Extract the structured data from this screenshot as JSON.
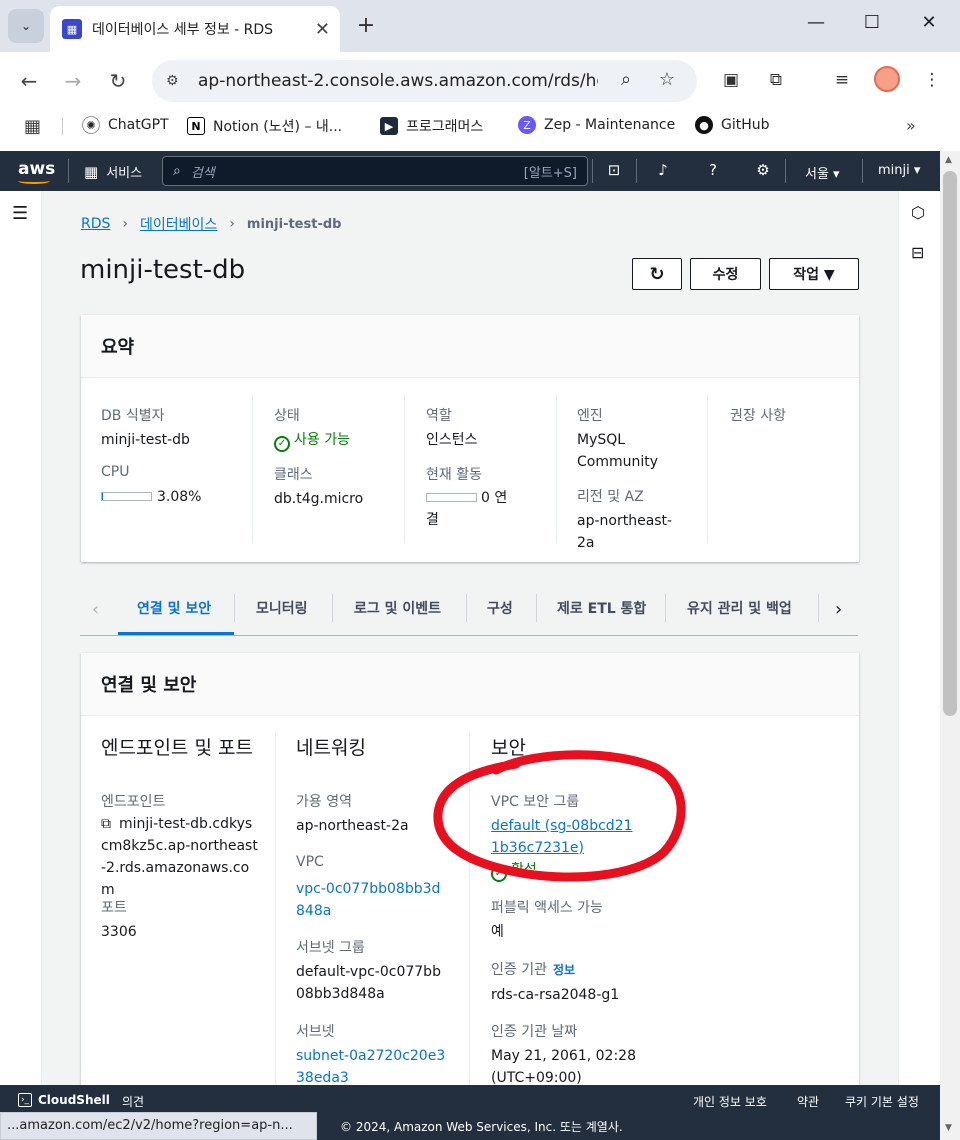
{
  "browser": {
    "tab_title": "데이터베이스 세부 정보 - RDS",
    "url": "ap-northeast-2.console.aws.amazon.com/rds/ho...",
    "bookmarks": [
      "ChatGPT",
      "Notion (노션) – 내...",
      "프로그래머스",
      "Zep - Maintenance",
      "GitHub"
    ],
    "status_url": "...amazon.com/ec2/v2/home?region=ap-n..."
  },
  "aws_nav": {
    "logo": "aws",
    "services": "서비스",
    "search_placeholder": "검색",
    "search_shortcut": "[알트+S]",
    "region": "서울 ▾",
    "user": "minji ▾"
  },
  "breadcrumb": {
    "root": "RDS",
    "section": "데이터베이스",
    "current": "minji-test-db"
  },
  "page": {
    "title": "minji-test-db",
    "refresh_icon": "refresh-icon",
    "edit_label": "수정",
    "actions_label": "작업 ▼"
  },
  "summary": {
    "title": "요약",
    "db_id_label": "DB 식별자",
    "db_id": "minji-test-db",
    "cpu_label": "CPU",
    "cpu_value": "3.08%",
    "cpu_fraction": 0.0308,
    "status_label": "상태",
    "status": "사용 가능",
    "class_label": "클래스",
    "class": "db.t4g.micro",
    "role_label": "역할",
    "role": "인스턴스",
    "activity_label": "현재 활동",
    "activity_value": "0 연결",
    "activity_fraction": 0,
    "engine_label": "엔진",
    "engine": "MySQL Community",
    "region_az_label": "리전 및 AZ",
    "region_az": "ap-northeast-2a",
    "recommendations_label": "권장 사항"
  },
  "tabs": [
    "연결 및 보안",
    "모니터링",
    "로그 및 이벤트",
    "구성",
    "제로 ETL 통합",
    "유지 관리 및 백업"
  ],
  "connectivity": {
    "title": "연결 및 보안",
    "endpoint_section": "엔드포인트 및 포트",
    "endpoint_label": "엔드포인트",
    "endpoint": "minji-test-db.cdkys cm8kz5c.ap-northeast-2.rds.amazonaws.com",
    "port_label": "포트",
    "port": "3306",
    "network_section": "네트워킹",
    "az_label": "가용 영역",
    "az": "ap-northeast-2a",
    "vpc_label": "VPC",
    "vpc": "vpc-0c077bb08bb3d848a",
    "subnet_group_label": "서브넷 그룹",
    "subnet_group": "default-vpc-0c077bb08bb3d848a",
    "subnets_label": "서브넷",
    "subnet": "subnet-0a2720c20e338eda3",
    "security_section": "보안",
    "sg_label": "VPC 보안 그룹",
    "sg": "default (sg-08bcd211b36c7231e)",
    "sg_status": "활성",
    "public_label": "퍼블릭 액세스 가능",
    "public": "예",
    "ca_label": "인증 기관",
    "ca_info": "정보",
    "ca": "rds-ca-rsa2048-g1",
    "ca_date_label": "인증 기관 날짜",
    "ca_date": "May 21, 2061, 02:28 (UTC+09:00)"
  },
  "footer": {
    "cloudshell": "CloudShell",
    "feedback": "의견",
    "copyright": "© 2024, Amazon Web Services, Inc. 또는 계열사.",
    "privacy": "개인 정보 보호",
    "terms": "약관",
    "cookies": "쿠키 기본 설정"
  },
  "colors": {
    "aws_nav": "#232f3e",
    "link": "#0972d3",
    "success": "#037f0c",
    "annotation": "#e8101e"
  }
}
